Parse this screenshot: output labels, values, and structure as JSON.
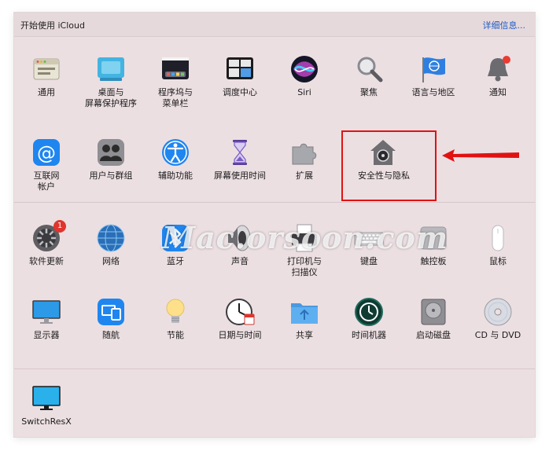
{
  "header": {
    "title": "开始使用 iCloud",
    "details_link": "详细信息..."
  },
  "section1": [
    {
      "id": "general",
      "label": "通用",
      "icon": "general-icon"
    },
    {
      "id": "desktop",
      "label": "桌面与\n屏幕保护程序",
      "icon": "desktop-screensaver-icon"
    },
    {
      "id": "dock",
      "label": "程序坞与\n菜单栏",
      "icon": "dock-menubar-icon"
    },
    {
      "id": "mission",
      "label": "调度中心",
      "icon": "mission-control-icon"
    },
    {
      "id": "siri",
      "label": "Siri",
      "icon": "siri-icon"
    },
    {
      "id": "spotlight",
      "label": "聚焦",
      "icon": "spotlight-icon"
    },
    {
      "id": "language",
      "label": "语言与地区",
      "icon": "language-region-icon"
    },
    {
      "id": "notifications",
      "label": "通知",
      "icon": "notifications-icon"
    },
    {
      "id": "internet",
      "label": "互联网\n帐户",
      "icon": "internet-accounts-icon"
    },
    {
      "id": "users",
      "label": "用户与群组",
      "icon": "users-groups-icon"
    },
    {
      "id": "accessibility",
      "label": "辅助功能",
      "icon": "accessibility-icon"
    },
    {
      "id": "screentime",
      "label": "屏幕使用时间",
      "icon": "screen-time-icon"
    },
    {
      "id": "extensions",
      "label": "扩展",
      "icon": "extensions-icon"
    },
    {
      "id": "security",
      "label": "安全性与隐私",
      "icon": "security-privacy-icon"
    }
  ],
  "section2": [
    {
      "id": "update",
      "label": "软件更新",
      "icon": "software-update-icon",
      "badge": "1"
    },
    {
      "id": "network",
      "label": "网络",
      "icon": "network-icon"
    },
    {
      "id": "bluetooth",
      "label": "蓝牙",
      "icon": "bluetooth-icon"
    },
    {
      "id": "sound",
      "label": "声音",
      "icon": "sound-icon"
    },
    {
      "id": "printers",
      "label": "打印机与\n扫描仪",
      "icon": "printers-scanners-icon"
    },
    {
      "id": "keyboard",
      "label": "键盘",
      "icon": "keyboard-icon"
    },
    {
      "id": "trackpad",
      "label": "触控板",
      "icon": "trackpad-icon"
    },
    {
      "id": "mouse",
      "label": "鼠标",
      "icon": "mouse-icon"
    },
    {
      "id": "displays",
      "label": "显示器",
      "icon": "displays-icon"
    },
    {
      "id": "sidecar",
      "label": "随航",
      "icon": "sidecar-icon"
    },
    {
      "id": "energy",
      "label": "节能",
      "icon": "energy-saver-icon"
    },
    {
      "id": "datetime",
      "label": "日期与时间",
      "icon": "date-time-icon"
    },
    {
      "id": "sharing",
      "label": "共享",
      "icon": "sharing-icon"
    },
    {
      "id": "timemachine",
      "label": "时间机器",
      "icon": "time-machine-icon"
    },
    {
      "id": "startup",
      "label": "启动磁盘",
      "icon": "startup-disk-icon"
    },
    {
      "id": "cddvd",
      "label": "CD 与 DVD",
      "icon": "cd-dvd-icon"
    }
  ],
  "section3": [
    {
      "id": "switchresx",
      "label": "SwitchResX",
      "icon": "switchresx-icon"
    }
  ],
  "watermark": "Mac.orsoon.com",
  "colors": {
    "window_bg": "#ecdfe2",
    "link": "#1f5cc4",
    "highlight": "#e01212"
  }
}
